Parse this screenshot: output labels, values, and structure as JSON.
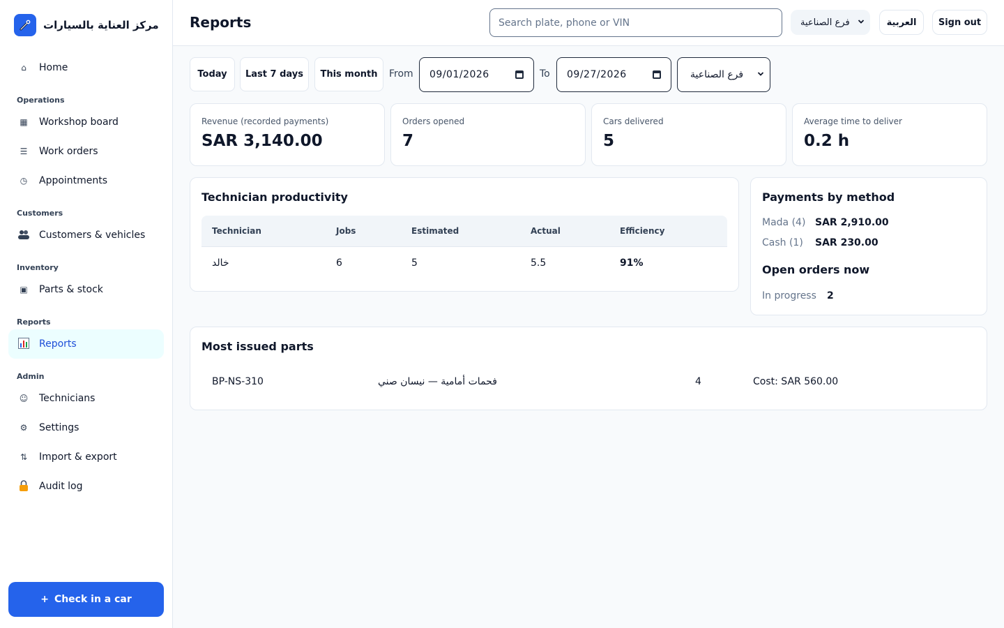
{
  "brand": {
    "name": "مركز العناية بالسيارات"
  },
  "sidebar": {
    "home": "Home",
    "sections": {
      "operations": "Operations",
      "customers": "Customers",
      "inventory": "Inventory",
      "reports": "Reports",
      "admin": "Admin"
    },
    "items": {
      "workshop_board": "Workshop board",
      "work_orders": "Work orders",
      "appointments": "Appointments",
      "customers_vehicles": "Customers & vehicles",
      "parts_stock": "Parts & stock",
      "reports": "Reports",
      "technicians": "Technicians",
      "settings": "Settings",
      "import_export": "Import & export",
      "audit_log": "Audit log"
    },
    "checkin_label": "Check in a car",
    "active": "reports"
  },
  "header": {
    "title": "Reports",
    "search_placeholder": "Search plate, phone or VIN",
    "branch": "فرع الصناعية",
    "language": "العربية",
    "sign_out": "Sign out"
  },
  "filters": {
    "today": "Today",
    "last7": "Last 7 days",
    "this_month": "This month",
    "from_label": "From",
    "from_date": "09/01/2026",
    "to_label": "To",
    "to_date": "09/27/2026",
    "branch": "فرع الصناعية"
  },
  "stats": [
    {
      "label": "Revenue (recorded payments)",
      "value": "SAR 3,140.00"
    },
    {
      "label": "Orders opened",
      "value": "7"
    },
    {
      "label": "Cars delivered",
      "value": "5"
    },
    {
      "label": "Average time to deliver",
      "value": "0.2 h"
    }
  ],
  "productivity": {
    "title": "Technician productivity",
    "columns": [
      "Technician",
      "Jobs",
      "Estimated",
      "Actual",
      "Efficiency"
    ],
    "rows": [
      {
        "technician": "خالد",
        "jobs": "6",
        "estimated": "5",
        "actual": "5.5",
        "efficiency": "91%"
      }
    ]
  },
  "payments": {
    "title": "Payments by method",
    "rows": [
      {
        "method": "Mada (4)",
        "amount": "SAR 2,910.00"
      },
      {
        "method": "Cash (1)",
        "amount": "SAR 230.00"
      }
    ],
    "open_title": "Open orders now",
    "open_rows": [
      {
        "status": "In progress",
        "count": "2"
      }
    ]
  },
  "parts": {
    "title": "Most issued parts",
    "rows": [
      {
        "sku": "BP-NS-310",
        "name": "فحمات أمامية — نيسان صني",
        "qty": "4",
        "cost": "Cost: SAR 560.00"
      }
    ]
  },
  "colors": {
    "primary": "#2563eb",
    "active_bg": "#ecfeff",
    "border": "#e2e8f0"
  }
}
